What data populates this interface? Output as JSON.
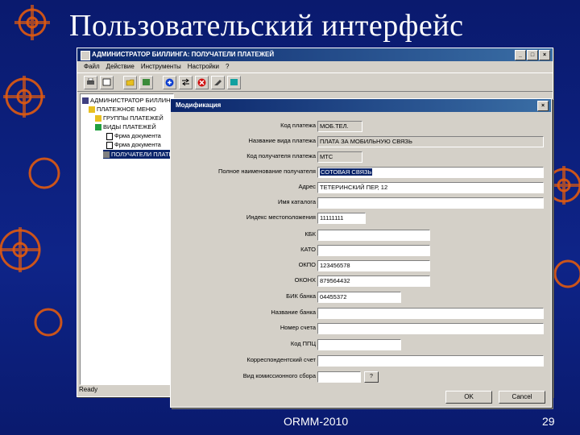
{
  "slide": {
    "title": "Пользовательский интерфейс",
    "footer": "ORMM-2010",
    "page": "29"
  },
  "main_window": {
    "title": "АДМИНИСТРАТОР БИЛЛИНГА: ПОЛУЧАТЕЛИ ПЛАТЕЖЕЙ",
    "menu": [
      "Файл",
      "Действие",
      "Инструменты",
      "Настройки",
      "?"
    ],
    "toolbar_icons": [
      "print-icon",
      "preview-icon",
      "folder-icon",
      "find-icon",
      "add-icon",
      "swap-icon",
      "delete-icon",
      "edit-icon",
      "export-icon"
    ],
    "tree": [
      {
        "label": "АДМИНИСТРАТОР БИЛЛИНГА",
        "icon": "app-icon"
      },
      {
        "label": "ПЛАТЕЖНОЕ МЕНЮ",
        "icon": "folder-icon"
      },
      {
        "label": "ГРУППЫ ПЛАТЕЖЕЙ",
        "icon": "folder-icon"
      },
      {
        "label": "ВИДЫ ПЛАТЕЖЕЙ",
        "icon": "folder-icon"
      },
      {
        "label": "Фрма документа",
        "icon": "doc-icon"
      },
      {
        "label": "Фрма документа",
        "icon": "doc-icon"
      },
      {
        "label": "ПОЛУЧАТЕЛИ ПЛАТЕЖЕЙ",
        "icon": "computer-icon"
      }
    ],
    "status": "Ready"
  },
  "dialog": {
    "title": "Модификация",
    "fields": [
      {
        "label": "Код платежа",
        "value": "МОБ.ТЕЛ.",
        "readonly": true
      },
      {
        "label": "Название вида платежа",
        "value": "ПЛАТА ЗА МОБИЛЬНУЮ СВЯЗЬ",
        "readonly": true
      },
      {
        "label": "Код получателя платежа",
        "value": "МТС",
        "readonly": true
      },
      {
        "label": "Полное наименование получателя",
        "value": "СОТОВАЯ СВЯЗЬ",
        "readonly": false
      },
      {
        "label": "Адрес",
        "value": "ТЕТЕРИНСКИЙ ПЕР, 12",
        "readonly": false
      },
      {
        "label": "Имя каталога",
        "value": "",
        "readonly": false
      },
      {
        "label": "Индекс местоположения",
        "value": "11111111",
        "readonly": false
      },
      {
        "label": "КБК",
        "value": "",
        "readonly": false
      },
      {
        "label": "КАТО",
        "value": "",
        "readonly": false
      },
      {
        "label": "ОКПО",
        "value": "123456578",
        "readonly": false
      },
      {
        "label": "ОКОНХ",
        "value": "879564432",
        "readonly": false
      },
      {
        "label": "БИК банка",
        "value": "04455372",
        "readonly": false
      },
      {
        "label": "Название банка",
        "value": "",
        "readonly": false
      },
      {
        "label": "Номер счета",
        "value": "",
        "readonly": false
      },
      {
        "label": "Код ППЦ",
        "value": "",
        "readonly": false
      },
      {
        "label": "Корреспондентский счет",
        "value": "",
        "readonly": false
      },
      {
        "label": "Вид комиссионного сбора",
        "value": "",
        "readonly": false
      }
    ],
    "help_button": "?",
    "ok": "OK",
    "cancel": "Cancel"
  }
}
